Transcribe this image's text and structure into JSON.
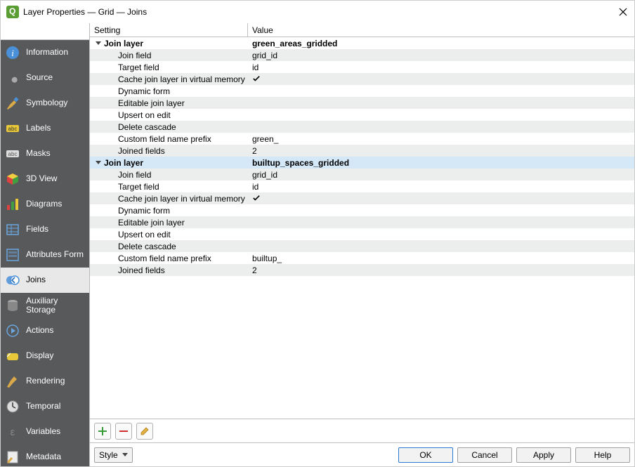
{
  "window": {
    "title": "Layer Properties — Grid — Joins"
  },
  "search": {
    "placeholder": ""
  },
  "sidebar": {
    "items": [
      {
        "label": "Information",
        "icon": "info"
      },
      {
        "label": "Source",
        "icon": "wrench"
      },
      {
        "label": "Symbology",
        "icon": "brush"
      },
      {
        "label": "Labels",
        "icon": "labels"
      },
      {
        "label": "Masks",
        "icon": "masks"
      },
      {
        "label": "3D View",
        "icon": "cube"
      },
      {
        "label": "Diagrams",
        "icon": "diagrams"
      },
      {
        "label": "Fields",
        "icon": "fields"
      },
      {
        "label": "Attributes Form",
        "icon": "form"
      },
      {
        "label": "Joins",
        "icon": "joins"
      },
      {
        "label": "Auxiliary Storage",
        "icon": "db"
      },
      {
        "label": "Actions",
        "icon": "actions"
      },
      {
        "label": "Display",
        "icon": "display"
      },
      {
        "label": "Rendering",
        "icon": "rendering"
      },
      {
        "label": "Temporal",
        "icon": "temporal"
      },
      {
        "label": "Variables",
        "icon": "variables"
      },
      {
        "label": "Metadata",
        "icon": "metadata"
      }
    ],
    "active_index": 9
  },
  "columns": {
    "setting": "Setting",
    "value": "Value"
  },
  "joins": [
    {
      "header_label": "Join layer",
      "header_value": "green_areas_gridded",
      "rows": [
        {
          "label": "Join field",
          "value": "grid_id"
        },
        {
          "label": "Target field",
          "value": "id"
        },
        {
          "label": "Cache join layer in virtual memory",
          "value_type": "check"
        },
        {
          "label": "Dynamic form",
          "value": ""
        },
        {
          "label": "Editable join layer",
          "value": ""
        },
        {
          "label": "Upsert on edit",
          "value": ""
        },
        {
          "label": "Delete cascade",
          "value": ""
        },
        {
          "label": "Custom field name prefix",
          "value": "green_"
        },
        {
          "label": "Joined fields",
          "value": "2"
        }
      ]
    },
    {
      "header_label": "Join layer",
      "header_value": "builtup_spaces_gridded",
      "rows": [
        {
          "label": "Join field",
          "value": "grid_id"
        },
        {
          "label": "Target field",
          "value": "id"
        },
        {
          "label": "Cache join layer in virtual memory",
          "value_type": "check"
        },
        {
          "label": "Dynamic form",
          "value": ""
        },
        {
          "label": "Editable join layer",
          "value": ""
        },
        {
          "label": "Upsert on edit",
          "value": ""
        },
        {
          "label": "Delete cascade",
          "value": ""
        },
        {
          "label": "Custom field name prefix",
          "value": "builtup_"
        },
        {
          "label": "Joined fields",
          "value": "2"
        }
      ]
    }
  ],
  "toolbar": {
    "style_label": "Style"
  },
  "buttons": {
    "ok": "OK",
    "cancel": "Cancel",
    "apply": "Apply",
    "help": "Help"
  }
}
